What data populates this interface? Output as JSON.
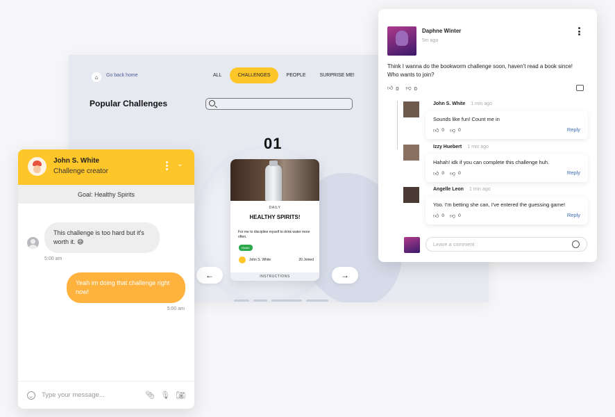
{
  "challenges_page": {
    "go_back": "Go back home",
    "nav": [
      "ALL",
      "CHALLENGES",
      "PEOPLE",
      "SURPRISE ME!"
    ],
    "active_nav": "CHALLENGES",
    "title": "Popular Challenges",
    "search_placeholder": "",
    "counter": "01",
    "card": {
      "category": "DAILY",
      "title": "HEALTHY SPIRITS!",
      "description": "For me to discipline myself to drink water more often.",
      "tag": "Health",
      "creator": "John S. White",
      "joined": "20 Joined",
      "instructions": "INSTRUCTIONS"
    },
    "prev_arrow": "←",
    "next_arrow": "→"
  },
  "chat": {
    "name": "John S. White",
    "role": "Challenge creator",
    "goal": "Goal: Healthy Spirits",
    "messages": [
      {
        "side": "left",
        "text": "This challenge is too hard but it's worth it. 😅",
        "time": "5:00 am"
      },
      {
        "side": "right",
        "text": "Yeah im doing that challenge right now!",
        "time": "5:00 am"
      }
    ],
    "input_placeholder": "Type your message..."
  },
  "comments": {
    "author": "Daphne Winter",
    "time": "5m ago",
    "text": "Think I wanna do the bookworm challenge soon, haven't read a book since! Who wants to join?",
    "likes": "0",
    "dislikes": "0",
    "replies": [
      {
        "name": "John S. White",
        "time": "1 min ago",
        "text": "Sounds like fun! Count me in",
        "likes": "0",
        "dislikes": "0",
        "reply_label": "Reply"
      },
      {
        "name": "Izzy Huebert",
        "time": "1 min ago",
        "text": "Hahah! idk if you can complete this challenge huh.",
        "likes": "0",
        "dislikes": "0",
        "reply_label": "Reply"
      },
      {
        "name": "Angelle Leon",
        "time": "1 min ago",
        "text": "Yoo. I'm betting she can, I've entered the guessing game!",
        "likes": "0",
        "dislikes": "0",
        "reply_label": "Reply"
      }
    ],
    "input_placeholder": "Leave a comment"
  },
  "colors": {
    "accent": "#ffc629",
    "bubble_right": "#ffb33e",
    "reply_link": "#3a6bb8",
    "tag_green": "#2da84d"
  }
}
